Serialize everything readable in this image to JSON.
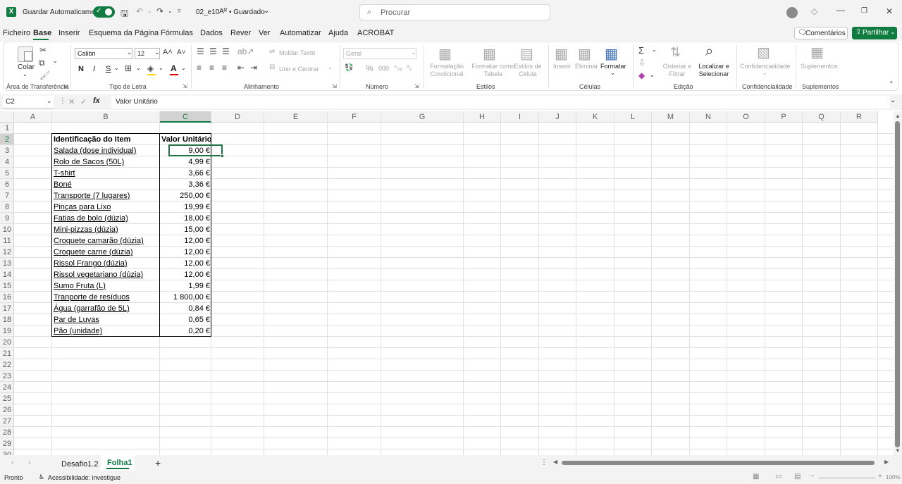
{
  "titlebar": {
    "autosave_label": "Guardar Automaticamente",
    "file_name": "02_e10",
    "save_status": "• Guardado",
    "search_placeholder": "Procurar"
  },
  "menu": {
    "items": [
      "Ficheiro",
      "Base",
      "Inserir",
      "Esquema da Página",
      "Fórmulas",
      "Dados",
      "Rever",
      "Ver",
      "Automatizar",
      "Ajuda",
      "ACROBAT"
    ],
    "active": "Base",
    "comments": "Comentários",
    "share": "Partilhar"
  },
  "ribbon": {
    "clipboard": {
      "paste": "Colar",
      "label": "Área de Transferência"
    },
    "font": {
      "name": "Calibri",
      "size": "12",
      "bold": "N",
      "italic": "I",
      "underline": "S",
      "label": "Tipo de Letra"
    },
    "alignment": {
      "wrap": "Moldar Texto",
      "merge": "Unir e Centrar",
      "label": "Alinhamento"
    },
    "number": {
      "format": "Geral",
      "label": "Número"
    },
    "styles": {
      "conditional": "Formatação Condicional",
      "table": "Formatar como Tabela",
      "cell": "Estilos de Célula",
      "label": "Estilos"
    },
    "cells": {
      "insert": "Inserir",
      "delete": "Eliminar",
      "format": "Formatar",
      "label": "Células"
    },
    "editing": {
      "sort": "Ordenar e Filtrar",
      "find": "Localizar e Selecionar",
      "label": "Edição"
    },
    "confidentiality": {
      "btn": "Confidencialidade",
      "label": "Confidencialidade"
    },
    "addins": {
      "btn": "Suplementos",
      "label": "Suplementos"
    }
  },
  "formula_bar": {
    "name_box": "C2",
    "fx": "fx",
    "content": "Valor Unitário"
  },
  "columns": [
    "A",
    "B",
    "C",
    "D",
    "E",
    "F",
    "G",
    "H",
    "I",
    "J",
    "K",
    "L",
    "M",
    "N",
    "O",
    "P",
    "Q",
    "R"
  ],
  "rows": [
    "1",
    "2",
    "3",
    "4",
    "5",
    "6",
    "7",
    "8",
    "9",
    "10",
    "11",
    "12",
    "13",
    "14",
    "15",
    "16",
    "17",
    "18",
    "19",
    "20",
    "21",
    "22",
    "23",
    "24",
    "25",
    "26",
    "27",
    "28",
    "29",
    "30"
  ],
  "table": {
    "headers": [
      "Identificação do Item",
      "Valor Unitário"
    ],
    "items": [
      {
        "name": "Salada (dose individual)",
        "value": "9,00 €"
      },
      {
        "name": "Rolo de Sacos (50L)",
        "value": "4,99 €"
      },
      {
        "name": "T-shirt",
        "value": "3,66 €"
      },
      {
        "name": "Boné",
        "value": "3,36 €"
      },
      {
        "name": "Transporte (7 lugares)",
        "value": "250,00 €"
      },
      {
        "name": "Pinças para Lixo",
        "value": "19,99 €"
      },
      {
        "name": "Fatias de bolo (dúzia)",
        "value": "18,00 €"
      },
      {
        "name": "Mini-pizzas (dúzia)",
        "value": "15,00 €"
      },
      {
        "name": "Croquete camarão (dúzia)",
        "value": "12,00 €"
      },
      {
        "name": "Croquete carne (dúzia)",
        "value": "12,00 €"
      },
      {
        "name": "Rissol Frango (dúzia)",
        "value": "12,00 €"
      },
      {
        "name": "Rissol vegetariano (dúzia)",
        "value": "12,00 €"
      },
      {
        "name": "Sumo Fruta (L)",
        "value": "1,99 €"
      },
      {
        "name": "Tranporte de resíduos",
        "value": "1 800,00 €"
      },
      {
        "name": "Água (garrafão de 5L)",
        "value": "0,84 €"
      },
      {
        "name": "Par de Luvas",
        "value": "0,65 €"
      },
      {
        "name": "Pão (unidade)",
        "value": "0,20 €"
      }
    ]
  },
  "sheets": {
    "tabs": [
      "Desafio1.2",
      "Folha1"
    ],
    "active": "Folha1"
  },
  "status": {
    "ready": "Pronto",
    "accessibility": "Acessibilidade: investigue",
    "zoom": "100%"
  },
  "colors": {
    "excel_green": "#107c41",
    "selection": "#217346",
    "share_green": "#0f7b3f"
  }
}
